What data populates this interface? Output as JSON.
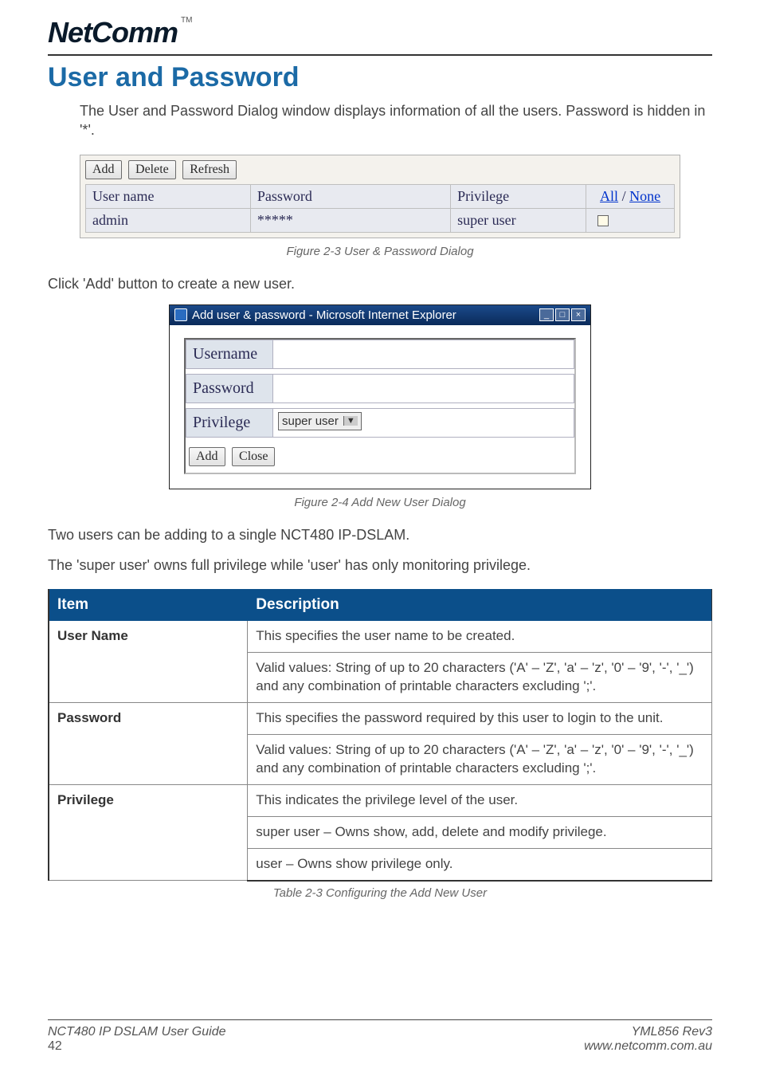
{
  "logo": {
    "text": "NetComm",
    "tm": "TM"
  },
  "title": "User and Password",
  "intro": "The User and Password Dialog window displays information of all the users. Password is hidden in '*'.",
  "dlg1": {
    "buttons": {
      "add": "Add",
      "delete": "Delete",
      "refresh": "Refresh"
    },
    "headers": {
      "user": "User name",
      "password": "Password",
      "privilege": "Privilege",
      "all": "All",
      "sep": " / ",
      "none": "None"
    },
    "row": {
      "user": "admin",
      "password": "*****",
      "privilege": "super user"
    }
  },
  "fig1": "Figure 2-3 User & Password Dialog",
  "clickAdd": "Click 'Add' button to create a new user.",
  "dlg2": {
    "title": "Add user & password - Microsoft Internet Explorer",
    "winbtns": {
      "min": "_",
      "max": "□",
      "close": "×"
    },
    "labels": {
      "username": "Username",
      "password": "Password",
      "privilege": "Privilege"
    },
    "selectValue": "super user",
    "buttons": {
      "add": "Add",
      "close": "Close"
    }
  },
  "fig2": "Figure 2-4 Add New User Dialog",
  "p2": "Two users can be adding to a single NCT480 IP-DSLAM.",
  "p3": "The 'super user' owns full privilege while 'user' has only monitoring privilege.",
  "table": {
    "headers": {
      "item": "Item",
      "desc": "Description"
    },
    "rows": [
      {
        "item": "User Name",
        "lines": [
          "This specifies the user name to be created.",
          "Valid values: String of up to 20 characters ('A' – 'Z', 'a' – 'z', '0' – '9', '-', '_') and any combination of printable characters excluding ';'."
        ]
      },
      {
        "item": "Password",
        "lines": [
          "This specifies the password required by this user to login to the unit.",
          "Valid values: String of up to 20 characters ('A' – 'Z', 'a' – 'z', '0' – '9', '-', '_') and any combination of printable characters excluding ';'."
        ]
      },
      {
        "item": "Privilege",
        "lines": [
          "This indicates the privilege level of the user.",
          "super user – Owns show, add, delete and modify privilege.",
          "user – Owns show privilege only."
        ]
      }
    ]
  },
  "tcap": "Table 2-3 Configuring the Add New User",
  "footer": {
    "leftTitle": "NCT480 IP DSLAM User Guide",
    "leftPage": "42",
    "rightRev": "YML856 Rev3",
    "rightUrl": "www.netcomm.com.au"
  }
}
